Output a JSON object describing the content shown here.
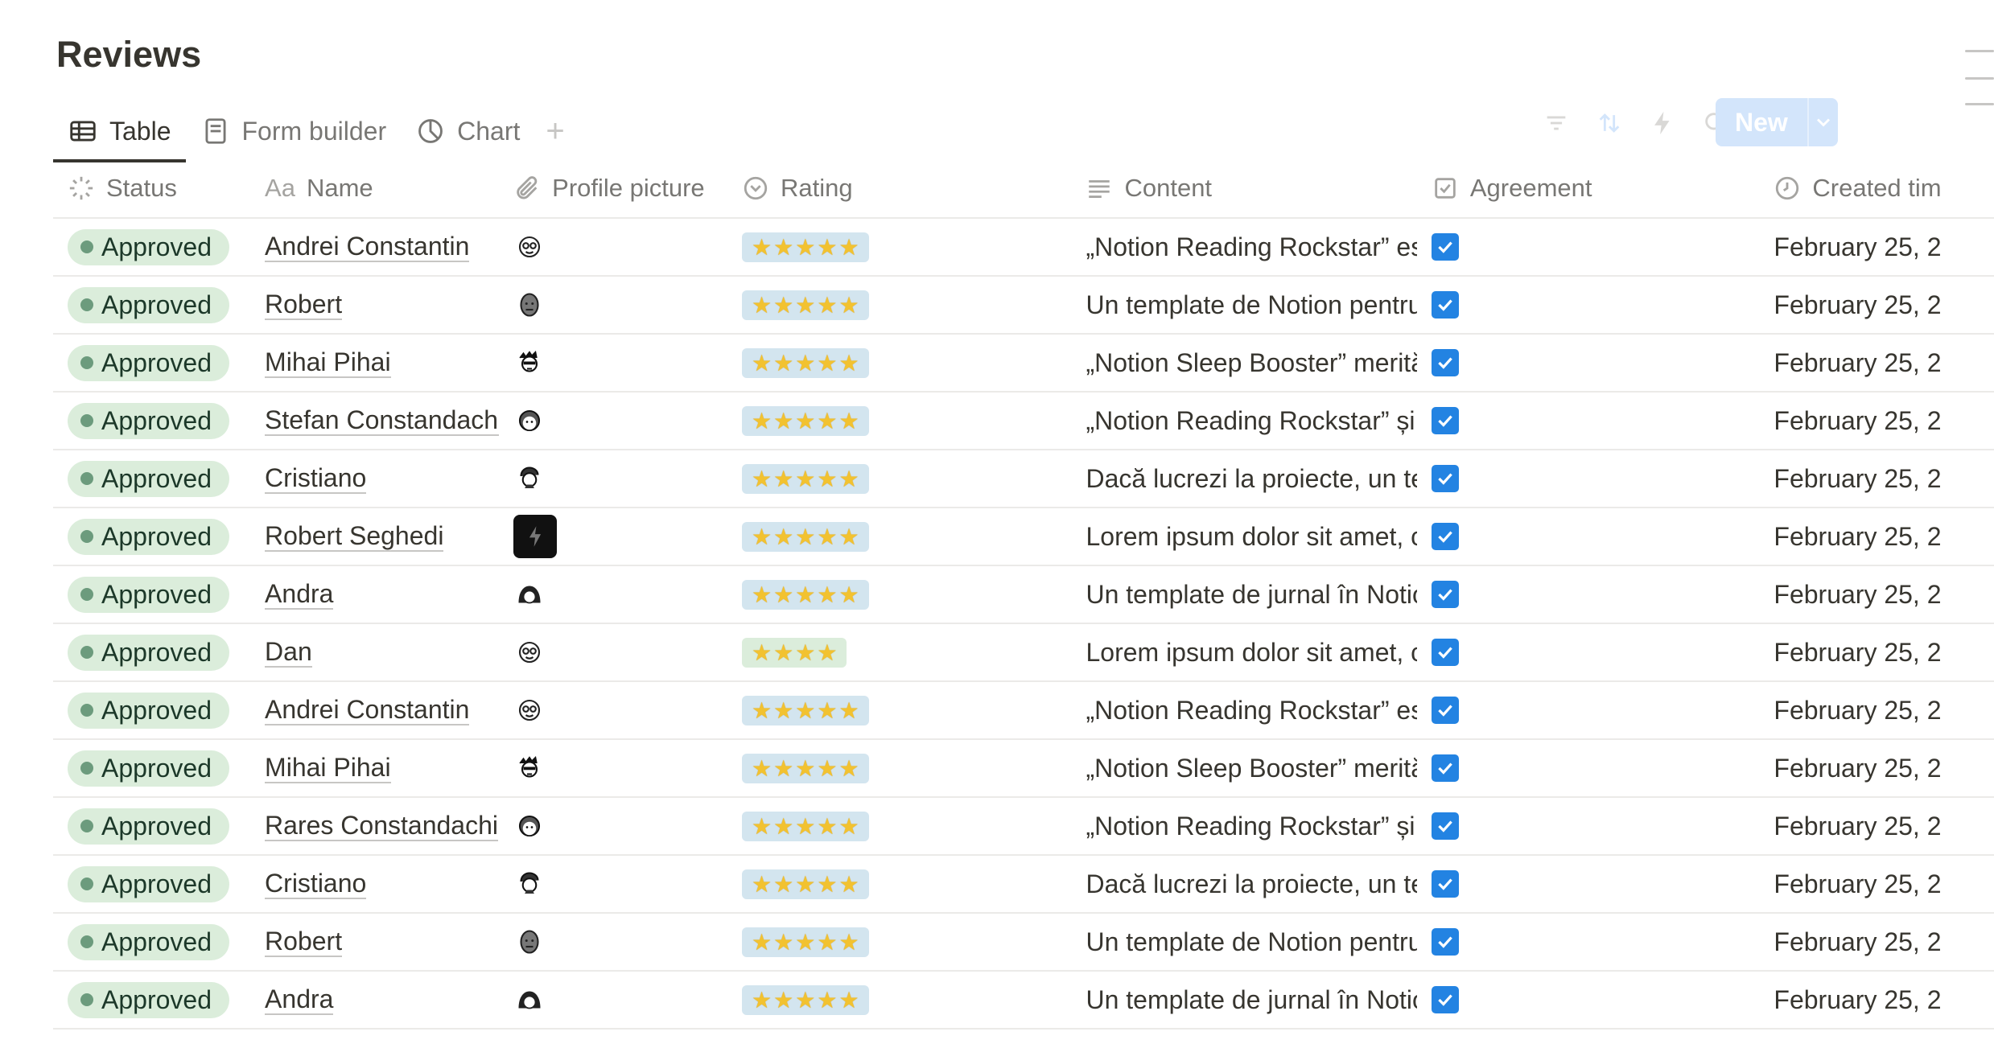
{
  "page": {
    "title": "Reviews"
  },
  "tabs": [
    {
      "label": "Table",
      "icon": "table-icon",
      "active": true
    },
    {
      "label": "Form builder",
      "icon": "form-icon",
      "active": false
    },
    {
      "label": "Chart",
      "icon": "chart-icon",
      "active": false
    }
  ],
  "toolbar": {
    "icons": [
      "filter-icon",
      "sort-icon",
      "lightning-icon",
      "search-icon",
      "expand-icon",
      "more-icon"
    ],
    "new_label": "New"
  },
  "columns": [
    {
      "label": "Status",
      "icon": "status-icon"
    },
    {
      "label": "Name",
      "icon": "text-aa-icon",
      "prefix": "Aa"
    },
    {
      "label": "Profile picture",
      "icon": "paperclip-icon"
    },
    {
      "label": "Rating",
      "icon": "select-icon"
    },
    {
      "label": "Content",
      "icon": "lines-icon"
    },
    {
      "label": "Agreement",
      "icon": "checkbox-icon"
    },
    {
      "label": "Created tim",
      "icon": "clock-icon"
    }
  ],
  "rows": [
    {
      "status": "Approved",
      "name": "Andrei Constantin",
      "avatar": "avatar-glasses-icon",
      "rating": 5,
      "content": "„Notion Reading Rockstar” es",
      "agreement": true,
      "created": "February 25, 2"
    },
    {
      "status": "Approved",
      "name": "Robert",
      "avatar": "avatar-bald-icon",
      "rating": 5,
      "content": "Un template de Notion pentru",
      "agreement": true,
      "created": "February 25, 2"
    },
    {
      "status": "Approved",
      "name": "Mihai Pihai",
      "avatar": "avatar-spiky-icon",
      "rating": 5,
      "content": "„Notion Sleep Booster” merită",
      "agreement": true,
      "created": "February 25, 2"
    },
    {
      "status": "Approved",
      "name": "Stefan Constandachi",
      "avatar": "avatar-round-icon",
      "rating": 5,
      "content": "„Notion Reading Rockstar” și",
      "agreement": true,
      "created": "February 25, 2"
    },
    {
      "status": "Approved",
      "name": "Cristiano",
      "avatar": "avatar-curly-icon",
      "rating": 5,
      "content": "Dacă lucrezi la proiecte, un te",
      "agreement": true,
      "created": "February 25, 2"
    },
    {
      "status": "Approved",
      "name": "Robert Seghedi",
      "avatar": "avatar-lightning-icon",
      "rating": 5,
      "content": "Lorem ipsum dolor sit amet, c",
      "agreement": true,
      "created": "February 25, 2"
    },
    {
      "status": "Approved",
      "name": "Andra",
      "avatar": "avatar-hair-icon",
      "rating": 5,
      "content": "Un template de jurnal în Notio",
      "agreement": true,
      "created": "February 25, 2"
    },
    {
      "status": "Approved",
      "name": "Dan",
      "avatar": "avatar-glasses-icon",
      "rating": 4,
      "content": "Lorem ipsum dolor sit amet, c",
      "agreement": true,
      "created": "February 25, 2"
    },
    {
      "status": "Approved",
      "name": "Andrei Constantin",
      "avatar": "avatar-glasses-icon",
      "rating": 5,
      "content": "„Notion Reading Rockstar” es",
      "agreement": true,
      "created": "February 25, 2"
    },
    {
      "status": "Approved",
      "name": "Mihai Pihai",
      "avatar": "avatar-spiky-icon",
      "rating": 5,
      "content": "„Notion Sleep Booster” merită",
      "agreement": true,
      "created": "February 25, 2"
    },
    {
      "status": "Approved",
      "name": "Rares Constandachi",
      "avatar": "avatar-round-icon",
      "rating": 5,
      "content": "„Notion Reading Rockstar” și",
      "agreement": true,
      "created": "February 25, 2"
    },
    {
      "status": "Approved",
      "name": "Cristiano",
      "avatar": "avatar-curly-icon",
      "rating": 5,
      "content": "Dacă lucrezi la proiecte, un te",
      "agreement": true,
      "created": "February 25, 2"
    },
    {
      "status": "Approved",
      "name": "Robert",
      "avatar": "avatar-bald-icon",
      "rating": 5,
      "content": "Un template de Notion pentru",
      "agreement": true,
      "created": "February 25, 2"
    },
    {
      "status": "Approved",
      "name": "Andra",
      "avatar": "avatar-hair-icon",
      "rating": 5,
      "content": "Un template de jurnal în Notio",
      "agreement": true,
      "created": "February 25, 2"
    }
  ],
  "colors": {
    "accent": "#2383e2",
    "status_bg": "#dbeddb",
    "status_dot": "#6c9b7d",
    "new_button": "#d3e5fb",
    "rating_bg": "#d3e5ef"
  }
}
